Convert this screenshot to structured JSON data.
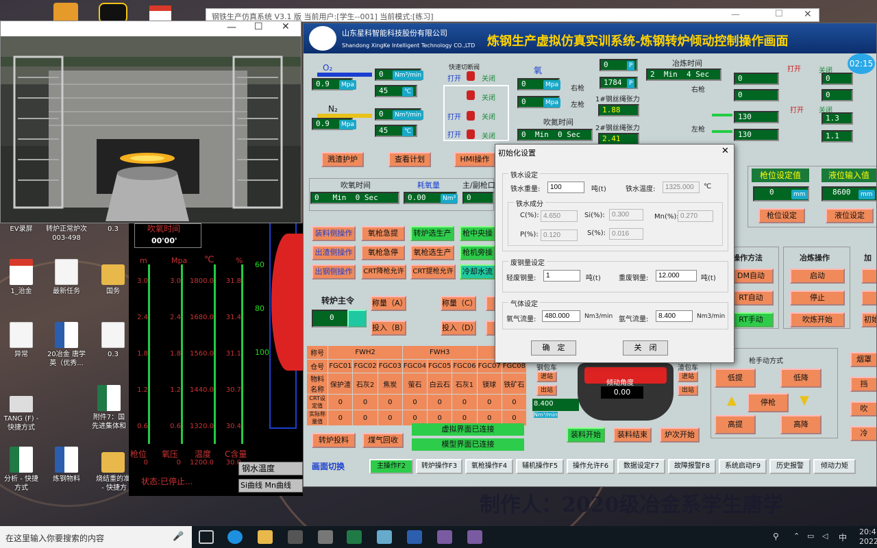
{
  "taskbar": {
    "search_placeholder": "在这里输入你要搜索的内容",
    "time": "20:4",
    "date": "2022/",
    "ime": "中"
  },
  "desktop": {
    "icons": [
      {
        "label": "EV录屏"
      },
      {
        "label": "转炉正常炉次\n003-498"
      },
      {
        "label": "0.3"
      },
      {
        "label": "1_治金"
      },
      {
        "label": "最新任务"
      },
      {
        "label": "国务"
      },
      {
        "label": "异常"
      },
      {
        "label": "20冶金 唐学\n英（优秀..."
      },
      {
        "label": "0.3"
      },
      {
        "label": "TANG (F) -\n快捷方式"
      },
      {
        "label": "附件7：国\n先进集体和"
      },
      {
        "label": "分析 - 快捷\n方式"
      },
      {
        "label": "炼钢物料"
      },
      {
        "label": "烧结重的准\n - 快捷方"
      }
    ]
  },
  "app": {
    "title": "钢铁生产仿真系统 V3.1 版 当前用户:[学生--001] 当前模式:[练习]",
    "company_cn": "山东星科智能科技股份有限公司",
    "company_en": "Shandong XingKe Intelligent Technology CO.,LTD",
    "screen_title": "炼钢生产虚拟仿真实训系统-炼钢转炉倾动控制操作画面",
    "clock": "02:15",
    "o2_label": "O₂",
    "n2_label": "N₂",
    "fast_valve": "快速切断阀",
    "open": "打开",
    "close": "关闭",
    "oxygen": "氧",
    "right_lance": "右枪",
    "left_lance": "左枪",
    "blow_n2_time": "吹氮时间",
    "rope1": "1#钢丝绳张力",
    "rope2": "2#钢丝绳张力",
    "smelt_time": "冶炼时间",
    "o2_flow": "0",
    "o2_press": "0.9",
    "o2_temp": "45",
    "n2_flow": "0",
    "n2_press": "0.9",
    "n2_temp": "45",
    "ox_right": "0",
    "ox_left": "0",
    "val_p1": "0",
    "val_p2": "1784",
    "rope1_val": "1.88",
    "rope2_val": "2.41",
    "n2_min": "0",
    "n2_sec": "0",
    "smelt_min": "2",
    "smelt_sec": "4",
    "r_vals": [
      "0",
      "0",
      "0",
      "0",
      "130",
      "1.3",
      "130",
      "1.1"
    ],
    "btn_slag": "溅渣护炉",
    "btn_plan": "查看计划",
    "btn_hmi": "HMI操作",
    "blow_time": "吹氧时间",
    "o2_use": "耗氧量",
    "main_sub_mouth": "主/副枪口",
    "blow_min": "0",
    "blow_sec": "0",
    "o2_use_val": "0.00",
    "mouth_val": "0",
    "lance_set": "枪位设定值",
    "liquid_in": "液位输入值",
    "lance_val": "0",
    "liquid_val": "8600",
    "lance_set_btn": "枪位设定",
    "liquid_btn": "液位设定",
    "ops": [
      "装料侧操作",
      "氧枪急提",
      "转炉选生产",
      "枪中央操"
    ],
    "ops2": [
      "出渣侧操作",
      "氧枪急停",
      "氧枪选生产",
      "枪机旁操"
    ],
    "ops3": [
      "出钢侧操作",
      "CRT降枪允许",
      "CRT提枪允许",
      "冷却水流"
    ],
    "converter_cmd": "转炉主令",
    "converter_val": "0",
    "weigh_a": "称量（A）",
    "feed_b": "投入（B）",
    "weigh_c": "称量（C）",
    "feed_d": "投入（D）",
    "op_method": "操作方法",
    "smelt_op": "冶炼操作",
    "add": "加",
    "op_auto1": "DM自动",
    "op_auto2": "RT自动",
    "op_manual": "RT手动",
    "start": "启动",
    "stop": "停止",
    "blow_start": "吹炼开始",
    "init": "初始",
    "lance_manual": "枪手动方式",
    "lance_btns": [
      "低提",
      "低降",
      "停枪",
      "高提",
      "高降"
    ],
    "right_btns": [
      "烟罩",
      "挡",
      "吹",
      "冷"
    ],
    "steel_car": "钢包车",
    "slag_car": "渣包车",
    "enter": "进站",
    "exit": "出站",
    "tilt_angle": "倾动角度",
    "tilt_val": "0.00",
    "flow_val": "8.400",
    "load_start": "装料开始",
    "load_end": "装料结束",
    "heat_start": "炉次开始",
    "feed_btn": "转炉投料",
    "gas_btn": "煤气回收",
    "virt_conn": "虚拟界面已连接",
    "model_conn": "模型界面已连接",
    "screen_switch": "画面切换",
    "nav": [
      "主操作F2",
      "转炉操作F3",
      "氧枪操作F4",
      "辅机操作F5",
      "操作允许F6",
      "数据设定F7",
      "故障报警F8",
      "系统启动F9",
      "历史报警",
      "倾动力矩"
    ],
    "table": {
      "name": "称号",
      "fwh2": "FWH2",
      "fwh3": "FWH3",
      "bin_no": "仓号",
      "mat_name": "物料名称",
      "crt_set": "CRT设定值",
      "actual": "实际称量值",
      "bins": [
        "FGC01",
        "FGC02",
        "FGC03",
        "FGC04",
        "FGC05",
        "FGC06",
        "FGC07",
        "FGC08"
      ],
      "mats": [
        "保护渣",
        "石灰2",
        "焦炭",
        "萤石",
        "白云石",
        "石灰1",
        "镁球",
        "铁矿石"
      ]
    }
  },
  "dark": {
    "blow_time": "吹氧时间",
    "blow_val": "00'00'",
    "units": [
      "m",
      "Mpa",
      "℃",
      "%"
    ],
    "col1": [
      "3.0",
      "2.4",
      "1.8",
      "1.2",
      "0.6",
      "0"
    ],
    "col2": [
      "3.0",
      "2.4",
      "1.8",
      "1.2",
      "0.6",
      "0"
    ],
    "col3": [
      "1800.0",
      "1680.0",
      "1560.0",
      "1440.0",
      "1320.0",
      "1200.0"
    ],
    "col4": [
      "31.8",
      "31.4",
      "31.1",
      "30.7",
      "30.4",
      "30.0"
    ],
    "right_scale": [
      "60",
      "80",
      "100"
    ],
    "bottom": [
      "枪位",
      "氧压",
      "温度",
      "C含量"
    ],
    "status": "状态:已停止...",
    "steel_temp": "钢水温度",
    "si_curve": "Si曲线",
    "mn_curve": "Mn曲线"
  },
  "dialog": {
    "title": "初始化设置",
    "iron_set": "铁水设定",
    "iron_weight": "铁水重量:",
    "iron_weight_val": "100",
    "ton": "吨(t)",
    "iron_temp": "铁水温度:",
    "iron_temp_val": "1325.000",
    "deg": "℃",
    "iron_comp": "铁水成分",
    "c": "C(%):",
    "c_val": "4.650",
    "si": "Si(%):",
    "si_val": "0.300",
    "mn": "Mn(%):",
    "mn_val": "0.270",
    "p": "P(%):",
    "p_val": "0.120",
    "s": "S(%):",
    "s_val": "0.016",
    "scrap_set": "废钢量设定",
    "light": "轻废钢量:",
    "light_val": "1",
    "heavy": "重废钢量:",
    "heavy_val": "12.000",
    "gas_set": "气体设定",
    "o2": "氧气流量:",
    "o2_val": "480.000",
    "unit_flow": "Nm3/min",
    "ar": "氩气流量:",
    "ar_val": "8.400",
    "ok": "确　定",
    "cancel": "关　闭"
  },
  "watermark": "制作人：2020级冶金系学生唐学"
}
